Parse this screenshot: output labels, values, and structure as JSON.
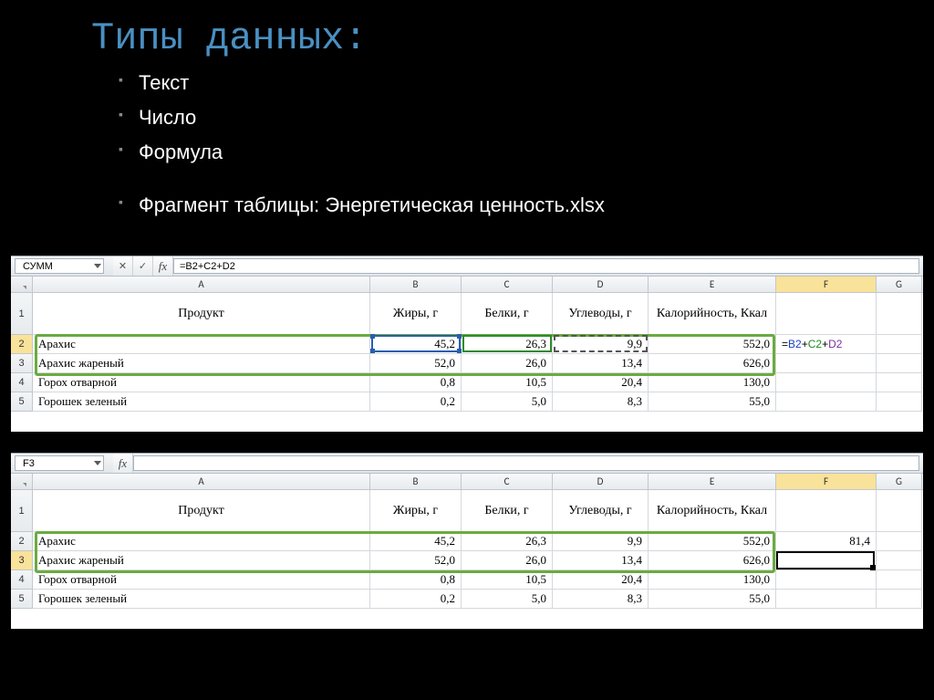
{
  "slide": {
    "title": "Типы данных:",
    "bullets": [
      "Текст",
      "Число",
      "Формула"
    ],
    "caption": "Фрагмент таблицы: Энергетическая ценность.xlsx"
  },
  "block1": {
    "name_box": "СУММ",
    "formula": "=B2+C2+D2",
    "columns": [
      "A",
      "B",
      "C",
      "D",
      "E",
      "F",
      "G"
    ],
    "selected_col": "F",
    "headers": {
      "A": "Продукт",
      "B": "Жиры, г",
      "C": "Белки, г",
      "D": "Углеводы, г",
      "E": "Калорийность, Ккал"
    },
    "rows": [
      {
        "n": "2",
        "A": "Арахис",
        "B": "45,2",
        "C": "26,3",
        "D": "9,9",
        "E": "552,0",
        "F": "=B2+C2+D2"
      },
      {
        "n": "3",
        "A": "Арахис жареный",
        "B": "52,0",
        "C": "26,0",
        "D": "13,4",
        "E": "626,0"
      },
      {
        "n": "4",
        "A": "Горох отварной",
        "B": "0,8",
        "C": "10,5",
        "D": "20,4",
        "E": "130,0"
      },
      {
        "n": "5",
        "A": "Горошек зеленый",
        "B": "0,2",
        "C": "5,0",
        "D": "8,3",
        "E": "55,0"
      }
    ],
    "editing_cell": "F2"
  },
  "block2": {
    "name_box": "F3",
    "formula": "",
    "columns": [
      "A",
      "B",
      "C",
      "D",
      "E",
      "F",
      "G"
    ],
    "selected_col": "F",
    "selected_row": "3",
    "headers": {
      "A": "Продукт",
      "B": "Жиры, г",
      "C": "Белки, г",
      "D": "Углеводы, г",
      "E": "Калорийность, Ккал"
    },
    "rows": [
      {
        "n": "2",
        "A": "Арахис",
        "B": "45,2",
        "C": "26,3",
        "D": "9,9",
        "E": "552,0",
        "F": "81,4"
      },
      {
        "n": "3",
        "A": "Арахис жареный",
        "B": "52,0",
        "C": "26,0",
        "D": "13,4",
        "E": "626,0"
      },
      {
        "n": "4",
        "A": "Горох отварной",
        "B": "0,8",
        "C": "10,5",
        "D": "20,4",
        "E": "130,0"
      },
      {
        "n": "5",
        "A": "Горошек зеленый",
        "B": "0,2",
        "C": "5,0",
        "D": "8,3",
        "E": "55,0"
      }
    ],
    "active_cell": "F3"
  }
}
